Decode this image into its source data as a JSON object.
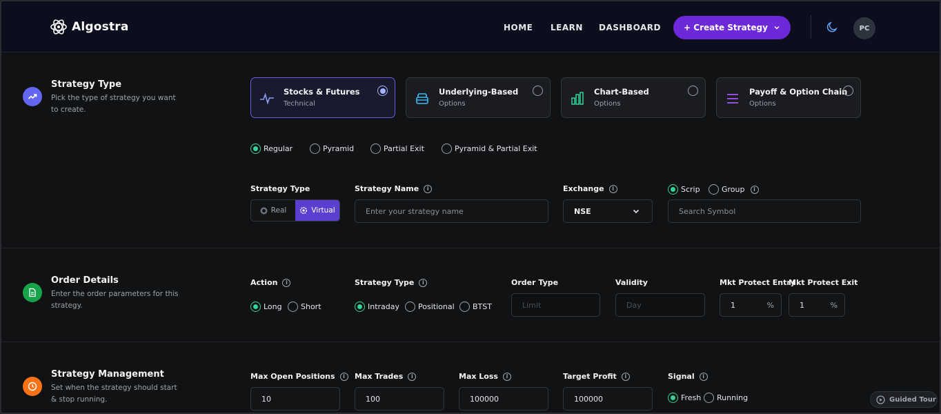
{
  "nav": {
    "logo_text": "Algostra",
    "links": [
      "HOME",
      "LEARN",
      "DASHBOARD"
    ],
    "create_label": "+ Create Strategy",
    "avatar_initials": "PC"
  },
  "strategy_type_section": {
    "title": "Strategy Type",
    "description": "Pick the type of strategy you want to create.",
    "cards": [
      {
        "title": "Stocks & Futures",
        "subtitle": "Technical",
        "selected": true
      },
      {
        "title": "Underlying-Based",
        "subtitle": "Options",
        "selected": false
      },
      {
        "title": "Chart-Based",
        "subtitle": "Options",
        "selected": false
      },
      {
        "title": "Payoff & Option Chain",
        "subtitle": "Options",
        "selected": false
      }
    ],
    "modes": [
      "Regular",
      "Pyramid",
      "Partial Exit",
      "Pyramid & Partial Exit"
    ],
    "selected_mode": "Regular",
    "strategy_type_label": "Strategy Type",
    "real_label": "Real",
    "virtual_label": "Virtual",
    "strategy_name_label": "Strategy Name",
    "strategy_name_placeholder": "Enter your strategy name",
    "exchange_label": "Exchange",
    "exchange_value": "NSE",
    "scrip_label": "Scrip",
    "group_label": "Group",
    "search_placeholder": "Search Symbol"
  },
  "order_section": {
    "title": "Order Details",
    "description": "Enter the order parameters for this strategy.",
    "action_label": "Action",
    "action_long": "Long",
    "action_short": "Short",
    "strategy_type_label": "Strategy Type",
    "intraday": "Intraday",
    "positional": "Positional",
    "btst": "BTST",
    "order_type_label": "Order Type",
    "order_type_value": "Limit",
    "validity_label": "Validity",
    "validity_value": "Day",
    "mkt_entry_label": "Mkt Protect Entry",
    "mkt_entry_value": "1",
    "mkt_exit_label": "Mkt Protect Exit",
    "mkt_exit_value": "1",
    "pct": "%"
  },
  "management_section": {
    "title": "Strategy Management",
    "description": "Set when the strategy should start & stop running.",
    "max_open_label": "Max Open Positions",
    "max_open_value": "10",
    "max_trades_label": "Max Trades",
    "max_trades_value": "100",
    "max_loss_label": "Max Loss",
    "max_loss_value": "100000",
    "target_profit_label": "Target Profit",
    "target_profit_value": "100000",
    "signal_label": "Signal",
    "signal_fresh": "Fresh",
    "signal_running": "Running"
  },
  "guided_tour_label": "Guided Tour",
  "colors": {
    "accent": "#6d28d9",
    "selected_card_border": "#6d5ce7",
    "radio_green": "#34d399",
    "section_icon_type": "#6366f1",
    "section_icon_order": "#16a34a",
    "section_icon_management": "#f97316"
  }
}
